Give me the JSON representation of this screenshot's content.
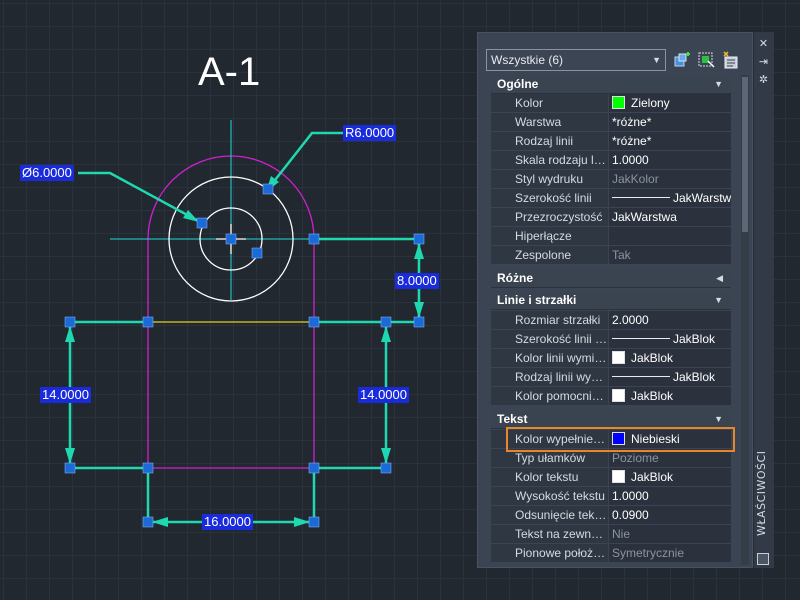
{
  "drawing": {
    "title": "A-1",
    "dimensions": {
      "radius": "R6.0000",
      "diameter": "Ø6.0000",
      "height_right": "8.0000",
      "height_left": "14.0000",
      "height_middle": "14.0000",
      "width_bottom": "16.0000"
    },
    "colors": {
      "background": "#212830",
      "dimension": "#20d8b0",
      "centerline": "#20d8d8",
      "arc": "#d020d0",
      "circle": "#ffffff",
      "midline": "#e0d020",
      "grip": "#1a6ad8",
      "label_bg": "#1a2bdc"
    }
  },
  "palette": {
    "title": "WŁAŚCIWOŚCI",
    "selection": "Wszystkie (6)",
    "strip_icons": [
      "close-icon",
      "pin-icon",
      "settings-icon"
    ],
    "toolbar_icons": [
      "add-to-selection-icon",
      "select-objects-icon",
      "quick-select-icon"
    ],
    "sections": {
      "general": {
        "label": "Ogólne",
        "rows": [
          {
            "name": "Kolor",
            "value": "Zielony",
            "swatch": "#00ff00"
          },
          {
            "name": "Warstwa",
            "value": "*różne*"
          },
          {
            "name": "Rodzaj linii",
            "value": "*różne*"
          },
          {
            "name": "Skala rodzaju linii",
            "value": "1.0000"
          },
          {
            "name": "Styl wydruku",
            "value": "JakKolor"
          },
          {
            "name": "Szerokość linii",
            "value": "JakWarstwa"
          },
          {
            "name": "Przezroczystość",
            "value": "JakWarstwa"
          },
          {
            "name": "Hiperłącze",
            "value": ""
          },
          {
            "name": "Zespolone",
            "value": "Tak"
          }
        ]
      },
      "misc": {
        "label": "Różne"
      },
      "lines": {
        "label": "Linie i strzałki",
        "rows": [
          {
            "name": "Rozmiar strzałki",
            "value": "2.0000"
          },
          {
            "name": "Szerokość linii wymiarowej",
            "value": "JakBlok"
          },
          {
            "name": "Kolor linii wymiarowej",
            "value": "JakBlok",
            "swatch": "#ffffff"
          },
          {
            "name": "Rodzaj linii wymiarowej",
            "value": "JakBlok"
          },
          {
            "name": "Kolor pomocniczej",
            "value": "JakBlok",
            "swatch": "#ffffff"
          }
        ]
      },
      "text": {
        "label": "Tekst",
        "rows": [
          {
            "name": "Kolor wypełnienia",
            "value": "Niebieski",
            "swatch": "#0000ff"
          },
          {
            "name": "Typ ułamków",
            "value": "Poziome"
          },
          {
            "name": "Kolor tekstu",
            "value": "JakBlok",
            "swatch": "#ffffff"
          },
          {
            "name": "Wysokość tekstu",
            "value": "1.0000"
          },
          {
            "name": "Odsunięcie tekstu",
            "value": "0.0900"
          },
          {
            "name": "Tekst na zewnątrz",
            "value": "Nie"
          },
          {
            "name": "Pionowe położenie",
            "value": "Symetrycznie"
          }
        ]
      }
    }
  }
}
